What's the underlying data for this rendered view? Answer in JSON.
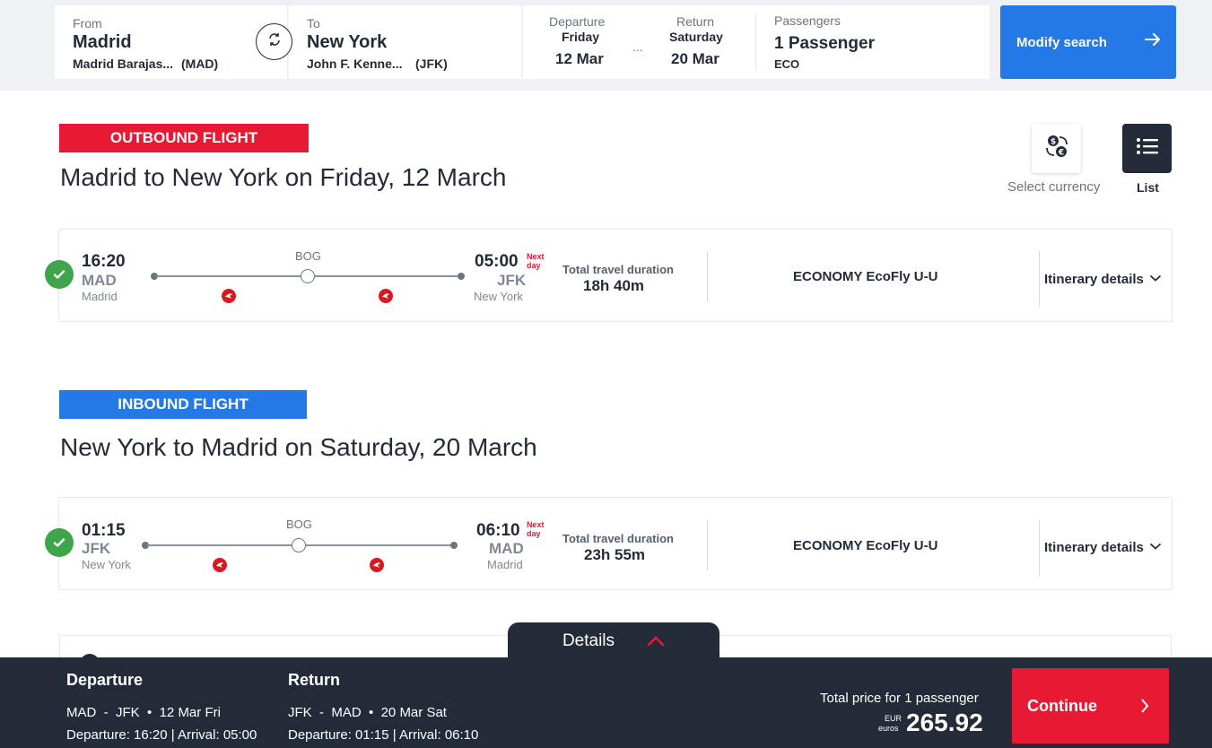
{
  "search": {
    "from_label": "From",
    "from_city": "Madrid",
    "from_airport": "Madrid Barajas...",
    "from_code": "(MAD)",
    "to_label": "To",
    "to_city": "New York",
    "to_airport": "John F. Kenne...",
    "to_code": "(JFK)",
    "departure_label": "Departure",
    "departure_day": "Friday",
    "departure_date": "12 Mar",
    "dates_sep": "...",
    "return_label": "Return",
    "return_day": "Saturday",
    "return_date": "20 Mar",
    "passengers_label": "Passengers",
    "passengers_value": "1 Passenger",
    "cabin": "ECO",
    "modify_label": "Modify search"
  },
  "toolbar": {
    "currency_label": "Select currency",
    "list_label": "List"
  },
  "outbound": {
    "tag": "OUTBOUND FLIGHT",
    "heading": "Madrid to New York on Friday, 12 March",
    "dep_time": "16:20",
    "dep_code": "MAD",
    "dep_city": "Madrid",
    "stop_code": "BOG",
    "arr_time": "05:00",
    "next_day": "Next day",
    "arr_code": "JFK",
    "arr_city": "New York",
    "duration_label": "Total travel duration",
    "duration": "18h 40m",
    "fare": "ECONOMY EcoFly U-U",
    "itinerary_label": "Itinerary details"
  },
  "inbound": {
    "tag": "INBOUND FLIGHT",
    "heading": "New York to Madrid on Saturday, 20 March",
    "dep_time": "01:15",
    "dep_code": "JFK",
    "dep_city": "New York",
    "stop_code": "BOG",
    "arr_time": "06:10",
    "next_day": "Next day",
    "arr_code": "MAD",
    "arr_city": "Madrid",
    "duration_label": "Total travel duration",
    "duration": "23h 55m",
    "fare": "ECONOMY EcoFly U-U",
    "itinerary_label": "Itinerary details"
  },
  "summary": {
    "details_label": "Details",
    "departure_head": "Departure",
    "departure_route": "MAD  -  JFK  •  12 Mar Fri",
    "departure_times": "Departure: 16:20 | Arrival: 05:00",
    "return_head": "Return",
    "return_route": "JFK  -  MAD  •  20 Mar Sat",
    "return_times": "Departure: 01:15 | Arrival: 06:10",
    "total_label": "Total price for 1 passenger",
    "currency_code": "EUR",
    "currency_word": "euros",
    "total_price": "265.92",
    "continue_label": "Continue"
  },
  "colors": {
    "brand_red": "#e81932",
    "brand_blue": "#2579e6",
    "dark_navy": "#232b38",
    "success_green": "#3fa54a"
  },
  "icons": [
    "swap-icon",
    "arrow-right-icon",
    "currency-exchange-icon",
    "list-icon",
    "check-icon",
    "turkish-airlines-logo-icon",
    "chevron-down-icon",
    "chevron-up-icon",
    "chevron-right-icon"
  ]
}
